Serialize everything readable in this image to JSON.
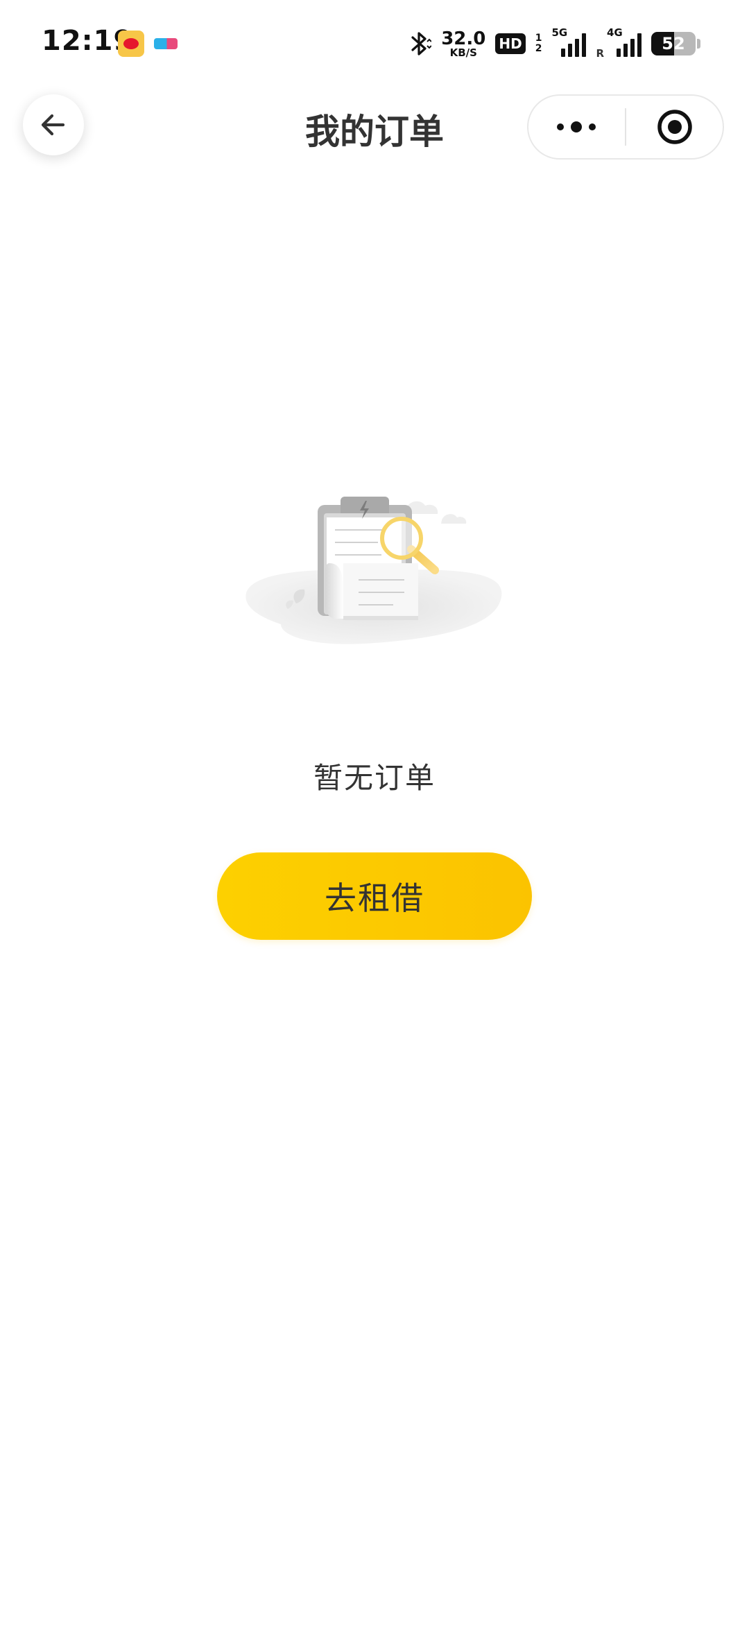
{
  "status_bar": {
    "time": "12:19",
    "apps": [
      "weibo-icon",
      "tct-icon"
    ],
    "net_speed_value": "32.0",
    "net_speed_unit": "KB/S",
    "hd_label": "HD",
    "sim_top": "1",
    "sim_bottom": "2",
    "signal1_tag": "5G",
    "signal2_tag": "4G",
    "roaming_label": "R",
    "battery_level": "52"
  },
  "nav": {
    "title": "我的订单"
  },
  "empty_state": {
    "message": "暂无订单",
    "action_label": "去租借"
  },
  "colors": {
    "accent": "#fdc800",
    "title_text": "#333333",
    "illustration_gray": "#b5b5b5"
  }
}
